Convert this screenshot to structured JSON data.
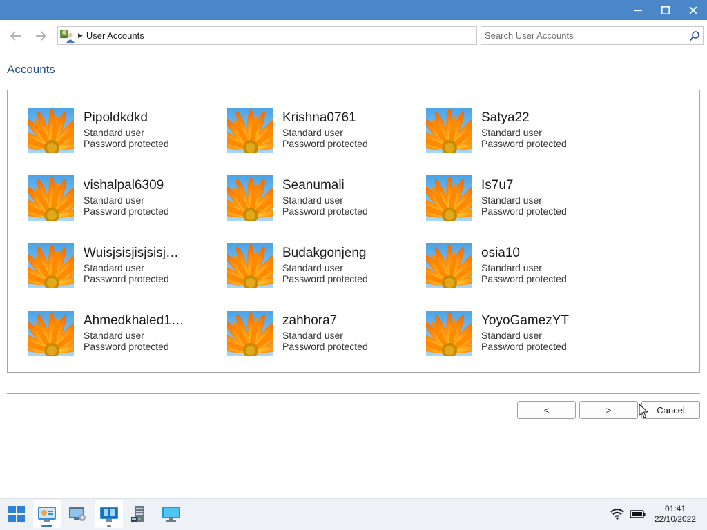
{
  "window": {
    "minimize_icon": "minimize-icon",
    "maximize_icon": "maximize-icon",
    "close_icon": "close-icon",
    "titlebar_color": "#4a86c8"
  },
  "navigation": {
    "back_icon": "arrow-left-icon",
    "forward_icon": "arrow-right-icon",
    "location_icon": "user-accounts-icon",
    "breadcrumb": "User Accounts"
  },
  "search": {
    "placeholder": "Search User Accounts",
    "value": "",
    "icon": "search-icon"
  },
  "section": {
    "title": "Accounts"
  },
  "accounts": [
    {
      "name": "Pipoldkdkd",
      "type": "Standard user",
      "status": "Password protected"
    },
    {
      "name": "Krishna0761",
      "type": "Standard user",
      "status": "Password protected"
    },
    {
      "name": "Satya22",
      "type": "Standard user",
      "status": "Password protected"
    },
    {
      "name": "vishalpal6309",
      "type": "Standard user",
      "status": "Password protected"
    },
    {
      "name": "Seanumali",
      "type": "Standard user",
      "status": "Password protected"
    },
    {
      "name": "Is7u7",
      "type": "Standard user",
      "status": "Password protected"
    },
    {
      "name": "Wuisjsisjisjsisj…",
      "type": "Standard user",
      "status": "Password protected"
    },
    {
      "name": "Budakgonjeng",
      "type": "Standard user",
      "status": "Password protected"
    },
    {
      "name": "osia10",
      "type": "Standard user",
      "status": "Password protected"
    },
    {
      "name": "Ahmedkhaled1…",
      "type": "Standard user",
      "status": "Password protected"
    },
    {
      "name": "zahhora7",
      "type": "Standard user",
      "status": "Password protected"
    },
    {
      "name": "YoyoGamezYT",
      "type": "Standard user",
      "status": "Password protected"
    }
  ],
  "buttons": {
    "prev": "<",
    "next": ">",
    "cancel": "Cancel"
  },
  "taskbar": {
    "items": [
      "start-icon",
      "control-panel-icon",
      "computer-management-icon",
      "windows-icon",
      "server-icon",
      "monitor-icon"
    ],
    "tray": [
      "wifi-icon",
      "battery-icon"
    ],
    "time": "01:41",
    "date": "22/10/2022",
    "accent": "#3b78c4"
  }
}
